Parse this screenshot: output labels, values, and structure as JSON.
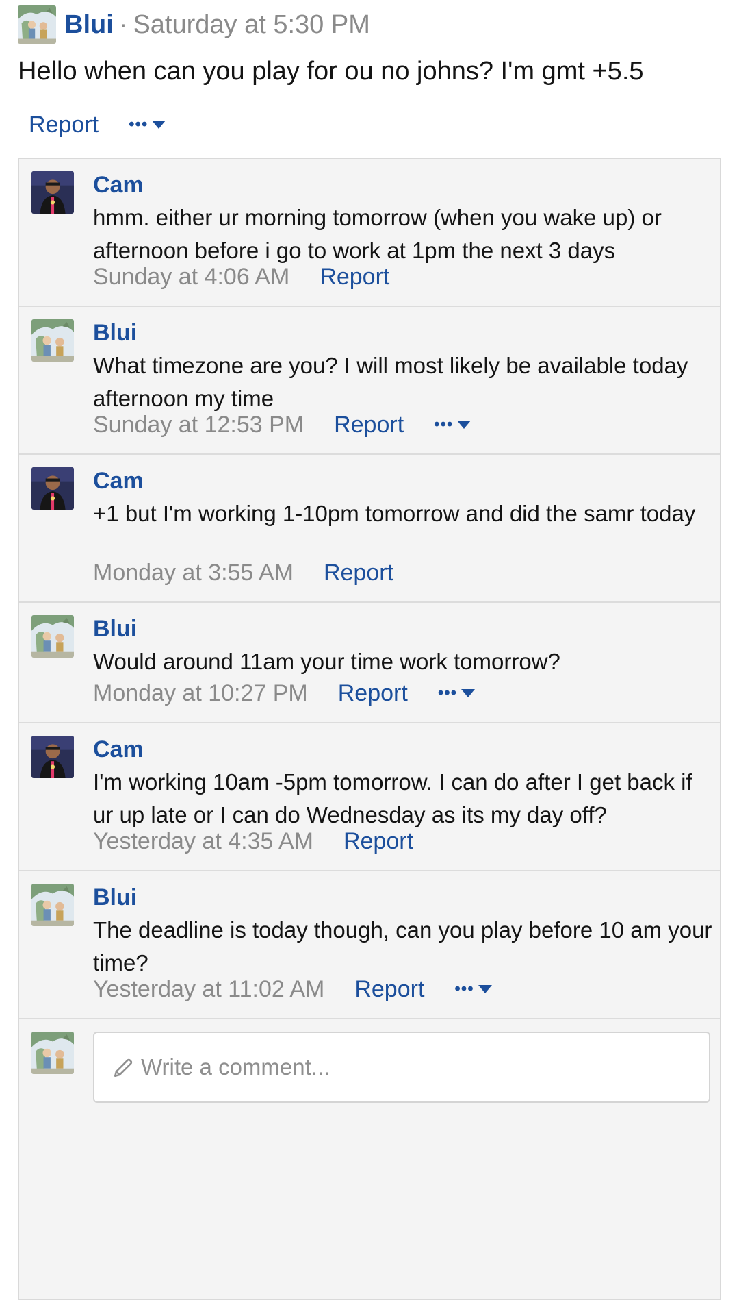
{
  "post": {
    "author": "Blui",
    "separator": "·",
    "time": "Saturday at 5:30 PM",
    "text": "Hello when can you play for ou no johns? I'm gmt +5.5",
    "report_label": "Report",
    "more_label": "•••"
  },
  "comments": [
    {
      "author": "Cam",
      "text": "hmm. either ur morning tomorrow (when you wake up) or afternoon before i go to work at 1pm the next 3 days",
      "time": "Sunday at 4:06 AM",
      "report_label": "Report"
    },
    {
      "author": "Blui",
      "text": "What timezone are you? I will most likely be available today afternoon my time",
      "time": "Sunday at 12:53 PM",
      "report_label": "Report",
      "more_label": "•••"
    },
    {
      "author": "Cam",
      "text": "+1 but I'm working 1-10pm tomorrow and did the samr today",
      "time": "Monday at 3:55 AM",
      "report_label": "Report"
    },
    {
      "author": "Blui",
      "text": "Would around 11am your time work tomorrow?",
      "time": "Monday at 10:27 PM",
      "report_label": "Report",
      "more_label": "•••"
    },
    {
      "author": "Cam",
      "text": "I'm working 10am -5pm tomorrow. I can do after I get back if ur up late or I can do Wednesday as its my day off?",
      "time": "Yesterday at 4:35 AM",
      "report_label": "Report"
    },
    {
      "author": "Blui",
      "text": "The deadline is today though, can you play before 10 am your time?",
      "time": "Yesterday at 11:02 AM",
      "report_label": "Report",
      "more_label": "•••"
    }
  ],
  "composer": {
    "placeholder": "Write a comment..."
  },
  "icons": {
    "more": "more-dots-icon",
    "caret": "caret-down-icon",
    "pencil": "pencil-icon"
  },
  "colors": {
    "link": "#1c4f9c",
    "muted": "#8a8a8a",
    "panel_bg": "#f4f4f4"
  }
}
